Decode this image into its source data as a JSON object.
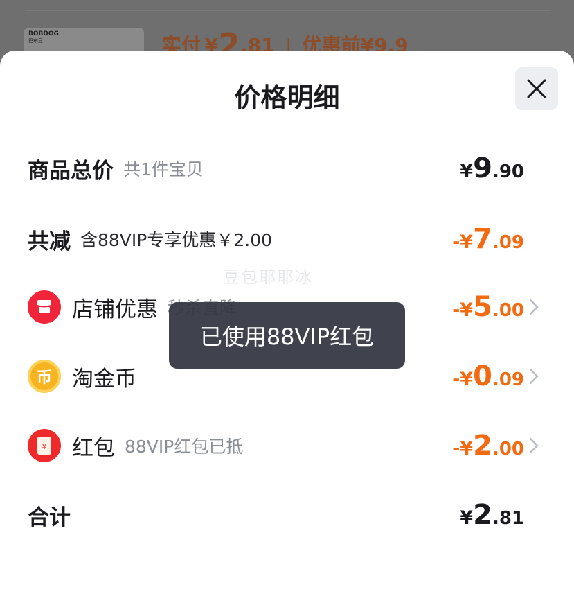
{
  "background": {
    "brand_logo": "BOBDOG",
    "brand_logo_sub": "巴布豆",
    "paid_label": "实付",
    "paid_currency": "¥",
    "paid_int": "2",
    "paid_dec": ".81",
    "separator": "|",
    "original_label": "优惠前",
    "original_price": "¥9.9"
  },
  "sheet": {
    "title": "价格明细",
    "close_icon": "close-icon"
  },
  "rows": {
    "total": {
      "label": "商品总价",
      "sub": "共1件宝贝",
      "currency": "¥",
      "int": "9",
      "dec": ".90"
    },
    "discount": {
      "label": "共减",
      "sub": "含88VIP专享优惠￥2.00",
      "currency": "-¥",
      "int": "7",
      "dec": ".09"
    },
    "shop": {
      "icon": "shop-icon",
      "label": "店铺优惠",
      "sub": "秒杀直降",
      "currency": "-¥",
      "int": "5",
      "dec": ".00"
    },
    "coin": {
      "icon": "coin-icon",
      "label": "淘金币",
      "currency": "-¥",
      "int": "0",
      "dec": ".09"
    },
    "redpacket": {
      "icon": "red-packet-icon",
      "label": "红包",
      "sub": "88VIP红包已抵",
      "currency": "-¥",
      "int": "2",
      "dec": ".00"
    },
    "sum": {
      "label": "合计",
      "currency": "¥",
      "int": "2",
      "dec": ".81"
    }
  },
  "toast": {
    "text": "已使用88VIP红包"
  },
  "watermark": "豆包耶耶冰",
  "colors": {
    "accent_orange": "#f26a12",
    "shop_icon_red": "#f0253a",
    "coin_yellow": "#f8b320",
    "redpacket_red": "#ee2a2a"
  }
}
